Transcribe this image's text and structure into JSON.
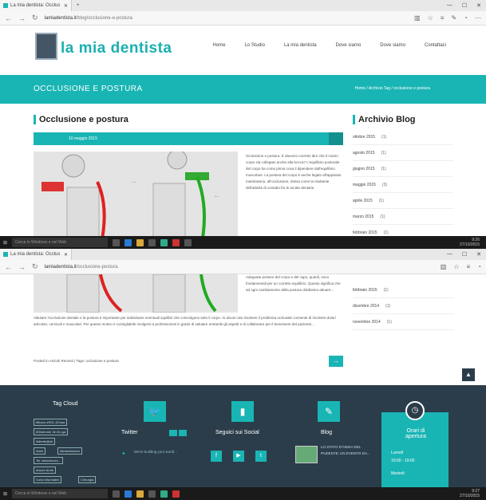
{
  "browser_top": {
    "tab_title": "La mia dentista: Occlus",
    "url_domain": "lamiadentista.it",
    "url_path": "/blog/occlusione-e-postura",
    "window_controls": [
      "—",
      "☐",
      "✕"
    ]
  },
  "site": {
    "logo_text": "la mia dentista",
    "menu": [
      "Home",
      "Lo Studio",
      "La mia dentista",
      "Dove siamo",
      "Dove siamo",
      "Contattaci"
    ]
  },
  "banner": {
    "title": "OCCLUSIONE E POSTURA",
    "breadcrumb": "Home / Archivio Tag / occlusione e postura"
  },
  "post": {
    "title": "Occlusione e postura",
    "date": "10 maggio 2015",
    "text_right": "Occlusione e postura. È davvero corretto dire che il nostro corpo sia collegato anche alla bocca? L'equilibrio posturale del corpo ha come prima cosa il dipendere dall'equilibrio muscolare. La postura del corpo è anche legato all'apparato masticatorio, all'occlusione, intesa come la risultante dell'attività di contatto fra le arcate dentarie.",
    "text_right2": "Adeguate posture del corpo e del capo, quindi, sono fondamentali per un corretto equilibrio. Questo significa che ad ogni cambiamento della postura dobbiamo attuare...",
    "text_full": "Valutare l'occlusione dentale e la postura è importante per individuare eventuali squilibri che coinvolgono tutto il corpo. In alcuni casi risolvere il problema occlusale consente di risolvere dolori articolari, cervicali e muscolari. Per questo motivo è consigliabile rivolgersi a professionisti in grado di valutare entrambi gli aspetti e di collaborare per il benessere del paziente...",
    "footer_meta": "Posted in Articoli Recenti | Tags: occlusione e postura"
  },
  "sidebar": {
    "title": "Archivio Blog",
    "archive_top": [
      {
        "label": "ottobre 2015",
        "count": "(1)"
      },
      {
        "label": "agosto 2015",
        "count": "(1)"
      },
      {
        "label": "giugno 2015",
        "count": "(1)"
      },
      {
        "label": "maggio 2015",
        "count": "(3)"
      },
      {
        "label": "aprile 2015",
        "count": "(1)"
      },
      {
        "label": "marzo 2015",
        "count": "(1)"
      },
      {
        "label": "febbraio 2015",
        "count": "(1)"
      }
    ],
    "archive_bottom": [
      {
        "label": "febbraio 2015",
        "count": "(1)"
      },
      {
        "label": "dicembre 2014",
        "count": "(1)"
      },
      {
        "label": "novembre 2014",
        "count": "(1)"
      }
    ]
  },
  "taskbar": {
    "search_placeholder": "Cerca in Windows e nel Web",
    "time_top": "9:26",
    "date_top": "27/10/2015",
    "time_bottom": "9:27",
    "date_bottom": "27/10/2015"
  },
  "browser_bottom": {
    "tab_title": "La mia dentista: Occlus",
    "url_domain": "lamiadentista.it",
    "url_path": "/occlusione-postura"
  },
  "footer": {
    "tag_cloud_title": "Tag Cloud",
    "tags": [
      "#fluoro #SOL #Cosa",
      "#Sindrome Jin Ku ga",
      "#diente@ok",
      "Arnie",
      "Alimentazione",
      "Tel. stanchezza...",
      "Amore Arnie",
      "Corsi Informativi",
      "Chirurgia"
    ],
    "twitter_title": "Twitter",
    "social_title": "Seguici sui Social",
    "blog_title": "Blog",
    "blog_post_title": "LO STATO D'ANSIA DEL PAZIENTE: UN EVENTO DA...",
    "hours_title": "Orari di apertura",
    "hours_lines": [
      "Lunedì",
      "10:00 - 19:00",
      "Martedì"
    ],
    "twitter_text": "We're building your world..."
  }
}
